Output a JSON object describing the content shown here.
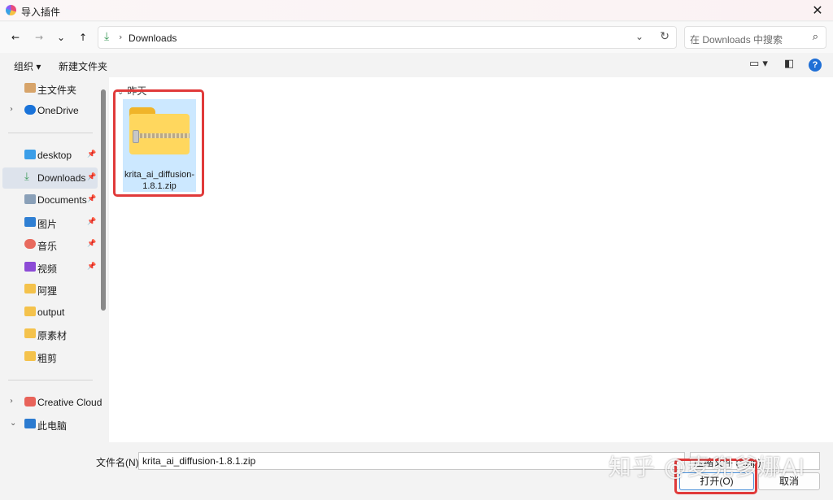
{
  "window": {
    "title": "导入插件"
  },
  "nav": {
    "back": "←",
    "forward": "→",
    "recent": "⌄",
    "up": "↑"
  },
  "address": {
    "path": "Downloads",
    "separator": "›"
  },
  "search": {
    "placeholder": "在 Downloads 中搜索"
  },
  "command_bar": {
    "organize": "组织 ▾",
    "new_folder": "新建文件夹",
    "help": "?"
  },
  "sidebar": {
    "items": [
      {
        "label": "主文件夹",
        "icon": "home-icon",
        "pinned": false
      },
      {
        "label": "OneDrive",
        "icon": "cloud-icon",
        "pinned": false
      },
      {
        "label": "desktop",
        "icon": "desktop-icon",
        "pinned": true
      },
      {
        "label": "Downloads",
        "icon": "download-icon",
        "pinned": true,
        "selected": true
      },
      {
        "label": "Documents",
        "icon": "document-icon",
        "pinned": true
      },
      {
        "label": "图片",
        "icon": "pictures-icon",
        "pinned": true
      },
      {
        "label": "音乐",
        "icon": "music-icon",
        "pinned": true
      },
      {
        "label": "视频",
        "icon": "video-icon",
        "pinned": true
      },
      {
        "label": "阿狸",
        "icon": "folder-icon",
        "pinned": false
      },
      {
        "label": "output",
        "icon": "folder-icon",
        "pinned": false
      },
      {
        "label": "原素材",
        "icon": "folder-icon",
        "pinned": false
      },
      {
        "label": "粗剪",
        "icon": "folder-icon",
        "pinned": false
      },
      {
        "label": "Creative Cloud",
        "icon": "creative-cloud-icon",
        "pinned": false
      },
      {
        "label": "此电脑",
        "icon": "computer-icon",
        "pinned": false
      }
    ]
  },
  "content": {
    "group": "昨天",
    "files": [
      {
        "name": "krita_ai_diffusion-1.8.1.zip",
        "type": "zip"
      }
    ]
  },
  "footer": {
    "filename_label": "文件名(N):",
    "filename_value": "krita_ai_diffusion-1.8.1.zip",
    "filter_value": "压缩文件 (*.zip)",
    "open_label": "打开(O)",
    "cancel_label": "取消"
  },
  "watermark": "知乎 @麦兜爹娜AI"
}
